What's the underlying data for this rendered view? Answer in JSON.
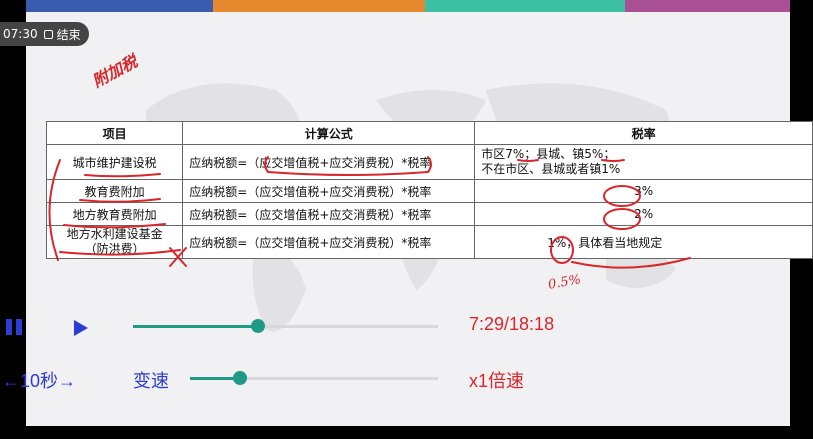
{
  "overlay": {
    "clock": "07:30",
    "end_label": "结束"
  },
  "top_bar_colors": [
    "#3a5cb0",
    "#e58a2e",
    "#3dbfa4",
    "#a94f93"
  ],
  "handwriting": {
    "note": "附加税"
  },
  "table": {
    "headers": [
      "项目",
      "计算公式",
      "税率"
    ],
    "rows": [
      {
        "item": "城市维护建设税",
        "formula": "应纳税额=（应交增值税+应交消费税）*税率",
        "rate_line1": "市区7%；县城、镇5%；",
        "rate_line2": "不在市区、县城或者镇1%"
      },
      {
        "item": "教育费附加",
        "formula": "应纳税额=（应交增值税+应交消费税）*税率",
        "rate": "3%"
      },
      {
        "item": "地方教育费附加",
        "formula": "应纳税额=（应交增值税+应交消费税）*税率",
        "rate": "2%"
      },
      {
        "item_line1": "地方水利建设基金",
        "item_line2": "（防洪费）",
        "formula": "应纳税额=（应交增值税+应交消费税）*税率",
        "rate_prefix": "1%",
        "rate_suffix": "，具体看当地规定"
      }
    ],
    "extra_note": "0.5%"
  },
  "player": {
    "time": "7:29/18:18",
    "progress_fraction": 0.41,
    "skip_label": "←10秒→",
    "speed_label": "变速",
    "speed_value": "x1倍速",
    "speed_fraction": 0.2,
    "accent": "#1f9a86",
    "icon_color": "#2d3cd1",
    "value_color": "#d9262b"
  }
}
